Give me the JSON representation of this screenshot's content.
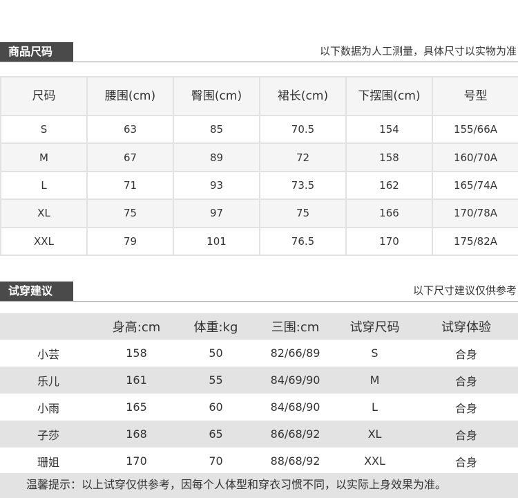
{
  "size_section": {
    "tag": "商品尺码",
    "note": "以下数据为人工测量，具体尺寸以实物为准",
    "headers": [
      "尺码",
      "腰围(cm)",
      "臀围(cm)",
      "裙长(cm)",
      "下摆围(cm)",
      "号型"
    ],
    "rows": [
      [
        "S",
        "63",
        "85",
        "70.5",
        "154",
        "155/66A"
      ],
      [
        "M",
        "67",
        "89",
        "72",
        "158",
        "160/70A"
      ],
      [
        "L",
        "71",
        "93",
        "73.5",
        "162",
        "165/74A"
      ],
      [
        "XL",
        "75",
        "97",
        "75",
        "166",
        "170/78A"
      ],
      [
        "XXL",
        "79",
        "101",
        "76.5",
        "170",
        "175/82A"
      ]
    ]
  },
  "try_section": {
    "tag": "试穿建议",
    "note": "以下尺寸建议仅供参考",
    "headers": [
      "",
      "身高:cm",
      "体重:kg",
      "三围:cm",
      "试穿尺码",
      "试穿体验"
    ],
    "rows": [
      [
        "小芸",
        "158",
        "50",
        "82/66/89",
        "S",
        "合身"
      ],
      [
        "乐儿",
        "161",
        "55",
        "84/69/90",
        "M",
        "合身"
      ],
      [
        "小雨",
        "165",
        "60",
        "84/68/90",
        "L",
        "合身"
      ],
      [
        "子莎",
        "168",
        "65",
        "86/68/92",
        "XL",
        "合身"
      ],
      [
        "珊姐",
        "170",
        "70",
        "88/68/92",
        "XXL",
        "合身"
      ]
    ],
    "footnote": "温馨提示：以上试穿仅供参考，因每个人体型和穿衣习惯不同，以实际上身效果为准。"
  }
}
